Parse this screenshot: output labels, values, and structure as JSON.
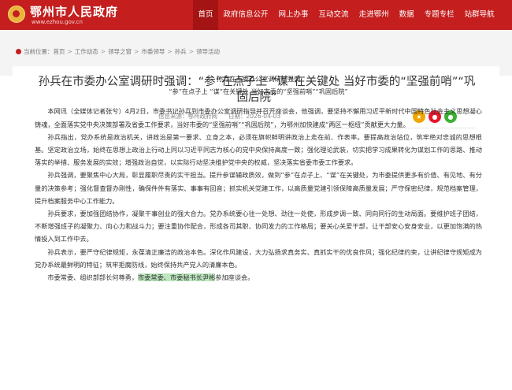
{
  "header": {
    "site_title": "鄂州市人民政府",
    "site_url": "www.ezhou.gov.cn",
    "nav": [
      "首页",
      "政府信息公开",
      "网上办事",
      "互动交流",
      "走进鄂州",
      "数据",
      "专题专栏",
      "站群导航"
    ]
  },
  "breadcrumb": [
    "当前位置：首页",
    "工作动态",
    "领导之窗",
    "市委领导",
    "孙兵",
    "领导活动"
  ],
  "article": {
    "headline": "孙兵在市委办公室调研时强调：“参”在点子上 “谋”在关键处 当好市委的“坚强前哨”“巩固后院”",
    "source_label": "信息来源：鄂州政府网",
    "date_label": "日期：2026-04-03",
    "subtitle_1": "孙兵在市委办公室调研时强调",
    "subtitle_2": "“参”在点子上 “谋”在关键处 当好市委的“坚强前哨”“巩固后院”",
    "paragraphs": [
      "本网讯（全媒体记者张兮）4月2日，市委书记孙兵到市委办公室调研指导并召开座谈会，他强调，要坚持不懈用习近平新时代中国特色社会主义思想凝心铸魂，全面落实党中央决策部署及省委工作要求，当好市委的“坚强前哨”“巩固后院”，为鄂州加快建成“两区一枢纽”贡献更大力量。",
      "孙兵指出，党办系统是政治机关，讲政治是第一要求、立身之本，必须在旗帜鲜明讲政治上走在前、作表率。要提高政治站位，筑牢绝对忠诚的思想根基。坚定政治立场，始终在思想上政治上行动上同以习近平同志为核心的党中央保持高度一致；强化理论武装，切实把学习成果转化为谋划工作的思路、推动落实的举措、服务发展的实效；增强政治自觉，以实际行动坚决维护党中央的权威，坚决落实省委市委工作要求。",
      "孙兵强调，要聚焦中心大局，彰显履职尽责的实干担当。提升参谋辅政质效，做到“参”在点子上、“谋”在关键处，为市委提供更多有价值、有见地、有分量的决策参考；强化督查督办刚性，确保件件有落实、事事有回音；抓实机关党建工作，以高质量党建引领保障高质量发展；严守保密纪律，规范档案管理，提升档案服务中心工作能力。",
      "孙兵要求，要加强团结协作，凝聚干事创业的强大合力。党办系统要心往一处想、劲往一处使，形成步调一致、同向同行的生动局面。要维护班子团结，不断增强班子的凝聚力、向心力和战斗力；要注重协作配合，形成各司其职、协同发力的工作格局；要关心关爱干部，让干部安心安身安业，以更加饱满的热情投入到工作中去。",
      "孙兵表示，要严守纪律规矩，永葆清正廉洁的政治本色。深化作风建设，大力弘扬求真务实、真抓实干的优良作风；强化纪律约束，让讲纪律守规矩成为党办系统最鲜明的特征；筑牢拒腐防线，始终保持共产党人的清廉本色。"
    ],
    "last_para_pre": "市委常委、组织部部长何尊勇，",
    "last_para_highlight": "市委常委、市委秘书长尹彬",
    "last_para_post": "参加座谈会。"
  }
}
